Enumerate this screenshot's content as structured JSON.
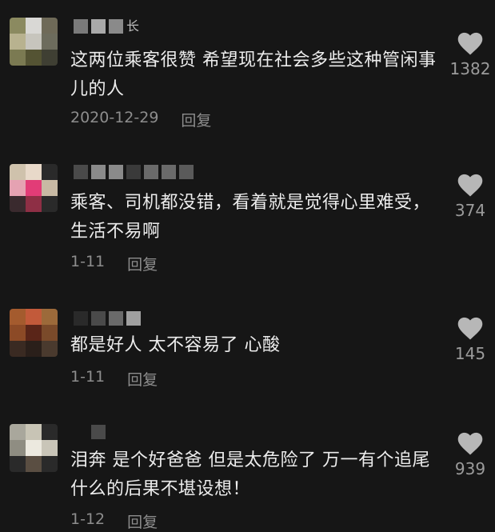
{
  "comments": [
    {
      "text": "这两位乘客很赞 希望现在社会多些这种管闲事儿的人",
      "date": "2020-12-29",
      "reply_label": "回复",
      "likes": "1382",
      "avatar_colors": [
        "#8b8a60",
        "#d9d8d5",
        "#6f6a58",
        "#b8b28f",
        "#c7c5bd",
        "#6d6c5d",
        "#7b7a52",
        "#545333",
        "#3f3f33"
      ],
      "username_colors": [
        "#7a7a7a",
        "#a9a9a9",
        "#8a8a8a"
      ],
      "username_suffix": "长"
    },
    {
      "text": "乘客、司机都没错，看着就是觉得心里难受，生活不易啊",
      "date": "1-11",
      "reply_label": "回复",
      "likes": "374",
      "avatar_colors": [
        "#cfc2ac",
        "#e8d9c9",
        "#2a2a2a",
        "#e5a2b2",
        "#e23c77",
        "#c8b9a4",
        "#3a2a2e",
        "#8e2f45",
        "#2a2a2a"
      ],
      "username_colors": [
        "#4a4a4a",
        "#8a8a8a",
        "#8a8a8a",
        "#3a3a3a",
        "#6a6a6a",
        "#6a6a6a",
        "#5a5a5a"
      ]
    },
    {
      "text": "都是好人 太不容易了 心酸",
      "date": "1-11",
      "reply_label": "回复",
      "likes": "145",
      "avatar_colors": [
        "#a45b2e",
        "#c25a3a",
        "#9c6a3a",
        "#8c4a26",
        "#5a2518",
        "#7a4a2a",
        "#3a2a22",
        "#2a1f1a",
        "#4a3a2e"
      ],
      "username_colors": [
        "#2a2a2a",
        "#4a4a4a",
        "#6a6a6a",
        "#a0a0a0"
      ]
    },
    {
      "text": "泪奔 是个好爸爸 但是太危险了 万一有个追尾什么的后果不堪设想！",
      "date": "1-12",
      "reply_label": "回复",
      "likes": "939",
      "avatar_colors": [
        "#a9a79c",
        "#c8c4b5",
        "#2a2a2a",
        "#8f8d82",
        "#ece9df",
        "#c9c5b8",
        "#2a2a2a",
        "#5a4e42",
        "#2a2a2a"
      ],
      "username_colors": [
        "#4a4a4a"
      ]
    }
  ]
}
